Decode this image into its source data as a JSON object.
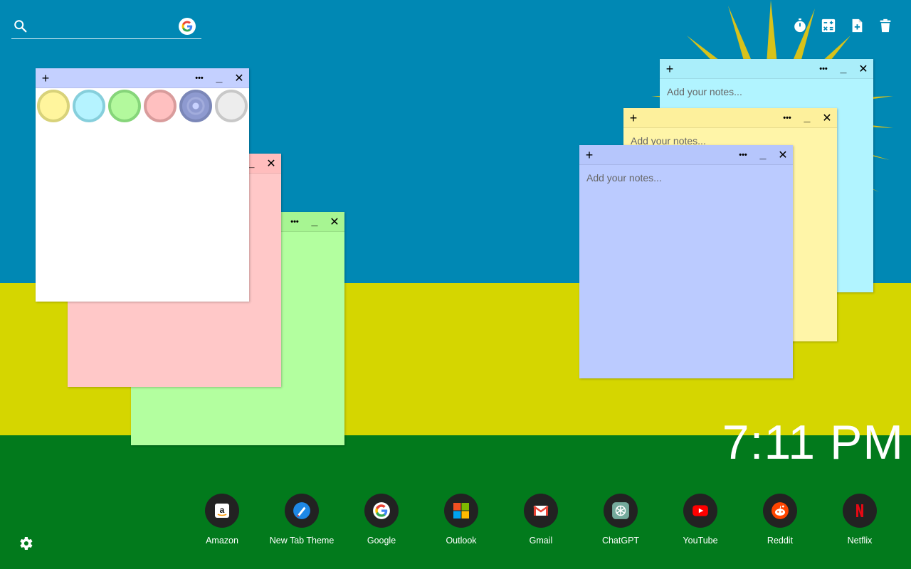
{
  "search": {
    "placeholder": ""
  },
  "toolbar": {
    "tools": [
      "timer-icon",
      "calculator-icon",
      "new-note-icon",
      "trash-icon"
    ]
  },
  "notes": {
    "placeholder": "Add your notes...",
    "add_label": "+",
    "menu_label": "•••",
    "minimize_label": "_",
    "close_label": "✕",
    "colors": {
      "white_header": "#c4d0ff",
      "pink": "#ffc8c8",
      "green": "#b3ff9f",
      "cyan": "#b1f4ff",
      "yellow": "#fff5a8",
      "blue": "#bbcbff"
    },
    "swatches": [
      {
        "name": "yellow",
        "fill": "#fff59d",
        "ring": "#d8d27a"
      },
      {
        "name": "cyan",
        "fill": "#b5f3ff",
        "ring": "#86cfdc"
      },
      {
        "name": "green",
        "fill": "#b3f99d",
        "ring": "#86d57a"
      },
      {
        "name": "pink",
        "fill": "#ffc0c0",
        "ring": "#d99c9c"
      },
      {
        "name": "blue",
        "fill": "#8e9ad0",
        "ring": "#7b87b8",
        "selected": true
      },
      {
        "name": "gray",
        "fill": "#ededed",
        "ring": "#c8c8c8"
      }
    ]
  },
  "clock": {
    "time": "7:11 PM"
  },
  "dock": {
    "items": [
      {
        "label": "Amazon",
        "icon": "amazon-icon"
      },
      {
        "label": "New Tab Theme",
        "icon": "new-tab-theme-icon"
      },
      {
        "label": "Google",
        "icon": "google-icon"
      },
      {
        "label": "Outlook",
        "icon": "outlook-icon"
      },
      {
        "label": "Gmail",
        "icon": "gmail-icon"
      },
      {
        "label": "ChatGPT",
        "icon": "chatgpt-icon"
      },
      {
        "label": "YouTube",
        "icon": "youtube-icon"
      },
      {
        "label": "Reddit",
        "icon": "reddit-icon"
      },
      {
        "label": "Netflix",
        "icon": "netflix-icon"
      }
    ]
  },
  "background": {
    "sky": "#0088b4",
    "field": "#d5d600",
    "grass": "#027a1c",
    "sun": "#d8c21a"
  }
}
